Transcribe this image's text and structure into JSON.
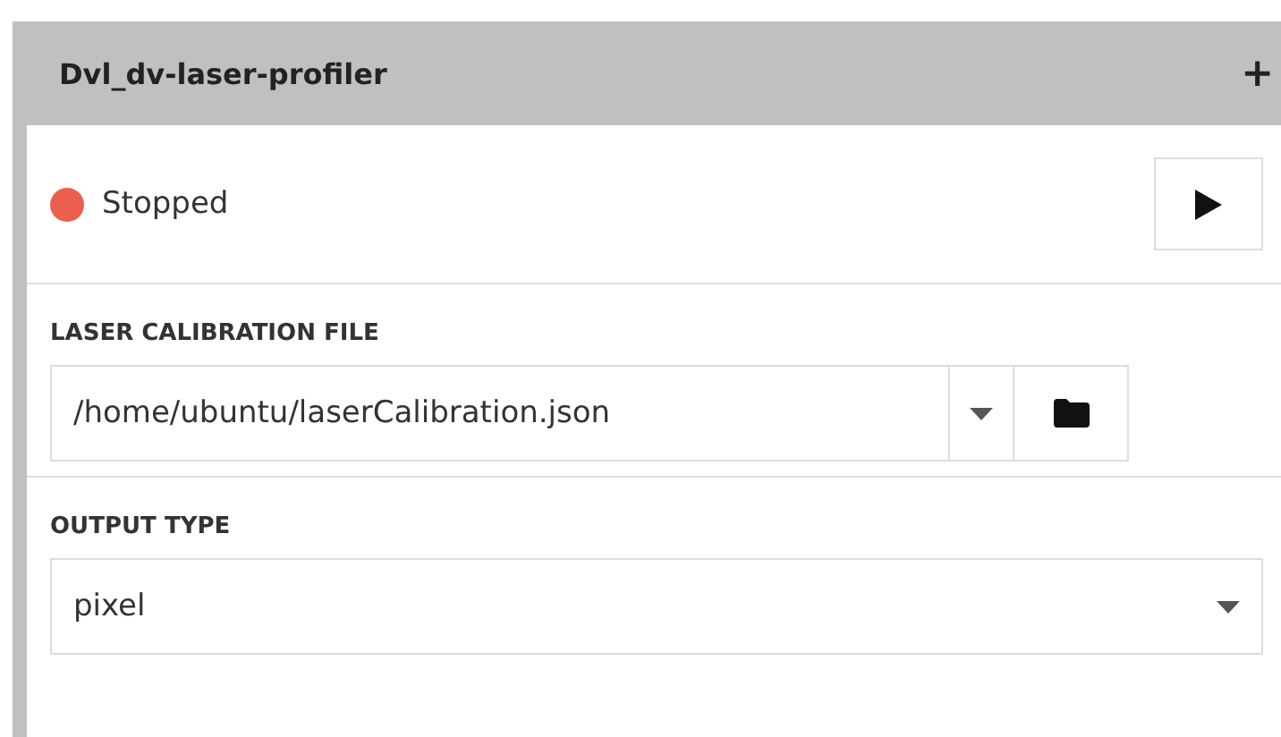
{
  "panel": {
    "title": "Dvl_dv-laser-profiler",
    "add_button": "+"
  },
  "status": {
    "label": "Stopped",
    "color": "#ec5f4e"
  },
  "fields": [
    {
      "kind": "file",
      "label": "LASER CALIBRATION FILE",
      "value": "/home/ubuntu/laserCalibration.json"
    },
    {
      "kind": "select",
      "label": "OUTPUT TYPE",
      "value": "pixel"
    }
  ]
}
